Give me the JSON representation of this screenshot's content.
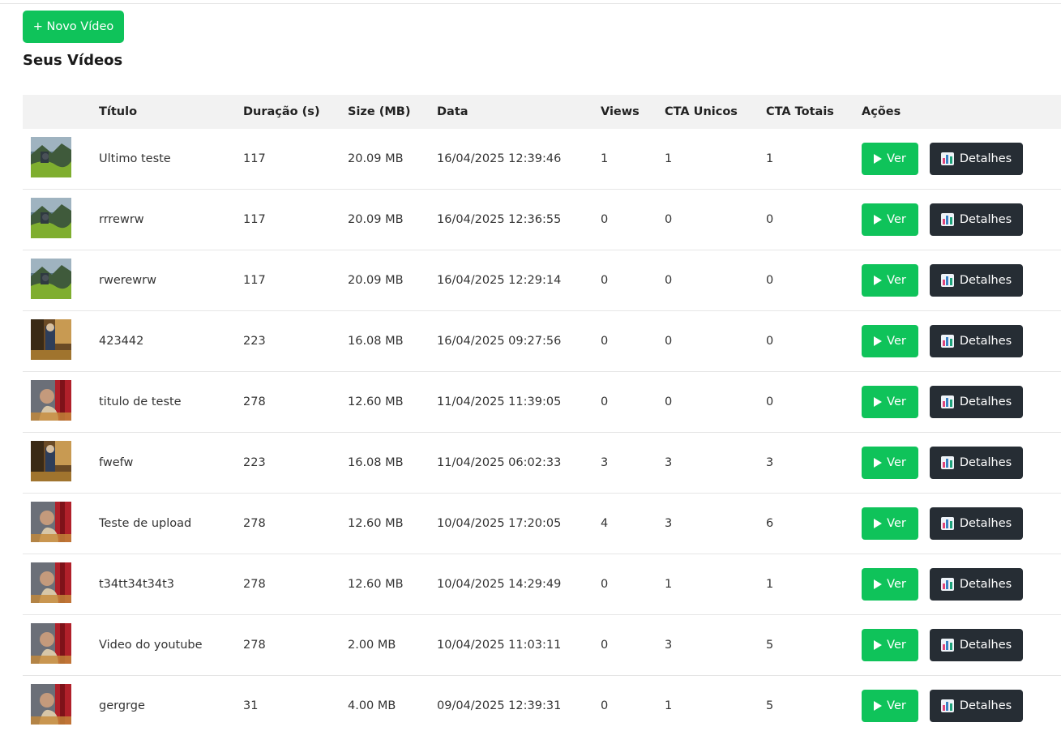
{
  "header": {
    "new_video_label": "+ Novo Vídeo",
    "section_title": "Seus Vídeos"
  },
  "table": {
    "columns": [
      "",
      "Título",
      "Duração (s)",
      "Size (MB)",
      "Data",
      "Views",
      "CTA Unicos",
      "CTA Totais",
      "Ações"
    ],
    "actions": {
      "view_label": "Ver",
      "details_label": "Detalhes"
    },
    "rows": [
      {
        "thumb": "landscape",
        "title": "Ultimo teste",
        "duration": "117",
        "size": "20.09 MB",
        "date": "16/04/2025 12:39:46",
        "views": "1",
        "cta_unique": "1",
        "cta_total": "1"
      },
      {
        "thumb": "landscape",
        "title": "rrrewrw",
        "duration": "117",
        "size": "20.09 MB",
        "date": "16/04/2025 12:36:55",
        "views": "0",
        "cta_unique": "0",
        "cta_total": "0"
      },
      {
        "thumb": "landscape",
        "title": "rwerewrw",
        "duration": "117",
        "size": "20.09 MB",
        "date": "16/04/2025 12:29:14",
        "views": "0",
        "cta_unique": "0",
        "cta_total": "0"
      },
      {
        "thumb": "interior",
        "title": "423442",
        "duration": "223",
        "size": "16.08 MB",
        "date": "16/04/2025 09:27:56",
        "views": "0",
        "cta_unique": "0",
        "cta_total": "0"
      },
      {
        "thumb": "person",
        "title": "titulo de teste",
        "duration": "278",
        "size": "12.60 MB",
        "date": "11/04/2025 11:39:05",
        "views": "0",
        "cta_unique": "0",
        "cta_total": "0"
      },
      {
        "thumb": "interior",
        "title": "fwefw",
        "duration": "223",
        "size": "16.08 MB",
        "date": "11/04/2025 06:02:33",
        "views": "3",
        "cta_unique": "3",
        "cta_total": "3"
      },
      {
        "thumb": "person",
        "title": "Teste de upload",
        "duration": "278",
        "size": "12.60 MB",
        "date": "10/04/2025 17:20:05",
        "views": "4",
        "cta_unique": "3",
        "cta_total": "6"
      },
      {
        "thumb": "person",
        "title": "t34tt34t34t3",
        "duration": "278",
        "size": "12.60 MB",
        "date": "10/04/2025 14:29:49",
        "views": "0",
        "cta_unique": "1",
        "cta_total": "1"
      },
      {
        "thumb": "person",
        "title": "Video do youtube",
        "duration": "278",
        "size": "2.00 MB",
        "date": "10/04/2025 11:03:11",
        "views": "0",
        "cta_unique": "3",
        "cta_total": "5"
      },
      {
        "thumb": "person",
        "title": "gergrge",
        "duration": "31",
        "size": "4.00 MB",
        "date": "09/04/2025 12:39:31",
        "views": "0",
        "cta_unique": "1",
        "cta_total": "5"
      }
    ]
  },
  "colors": {
    "accent_green": "#0fc35a",
    "dark_button": "#262d34",
    "header_bg": "#f2f2f2"
  }
}
